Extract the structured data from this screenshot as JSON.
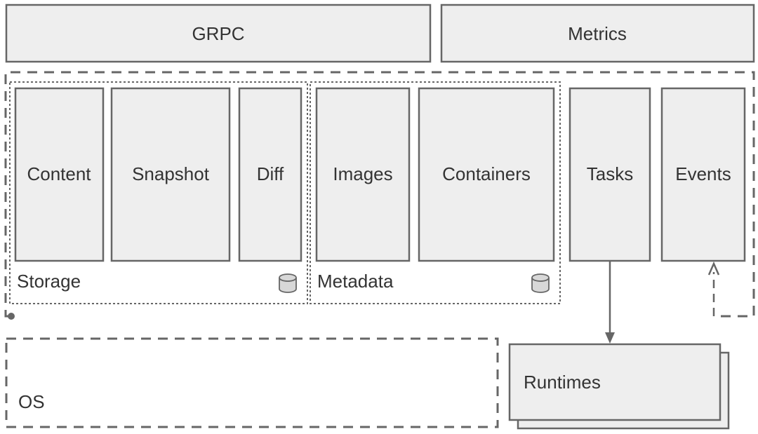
{
  "top": {
    "grpc": "GRPC",
    "metrics": "Metrics"
  },
  "groups": {
    "storage": {
      "label": "Storage",
      "items": [
        "Content",
        "Snapshot",
        "Diff"
      ]
    },
    "metadata": {
      "label": "Metadata",
      "items": [
        "Images",
        "Containers"
      ]
    }
  },
  "side": {
    "tasks": "Tasks",
    "events": "Events"
  },
  "bottom": {
    "os": "OS",
    "runtimes": "Runtimes"
  }
}
